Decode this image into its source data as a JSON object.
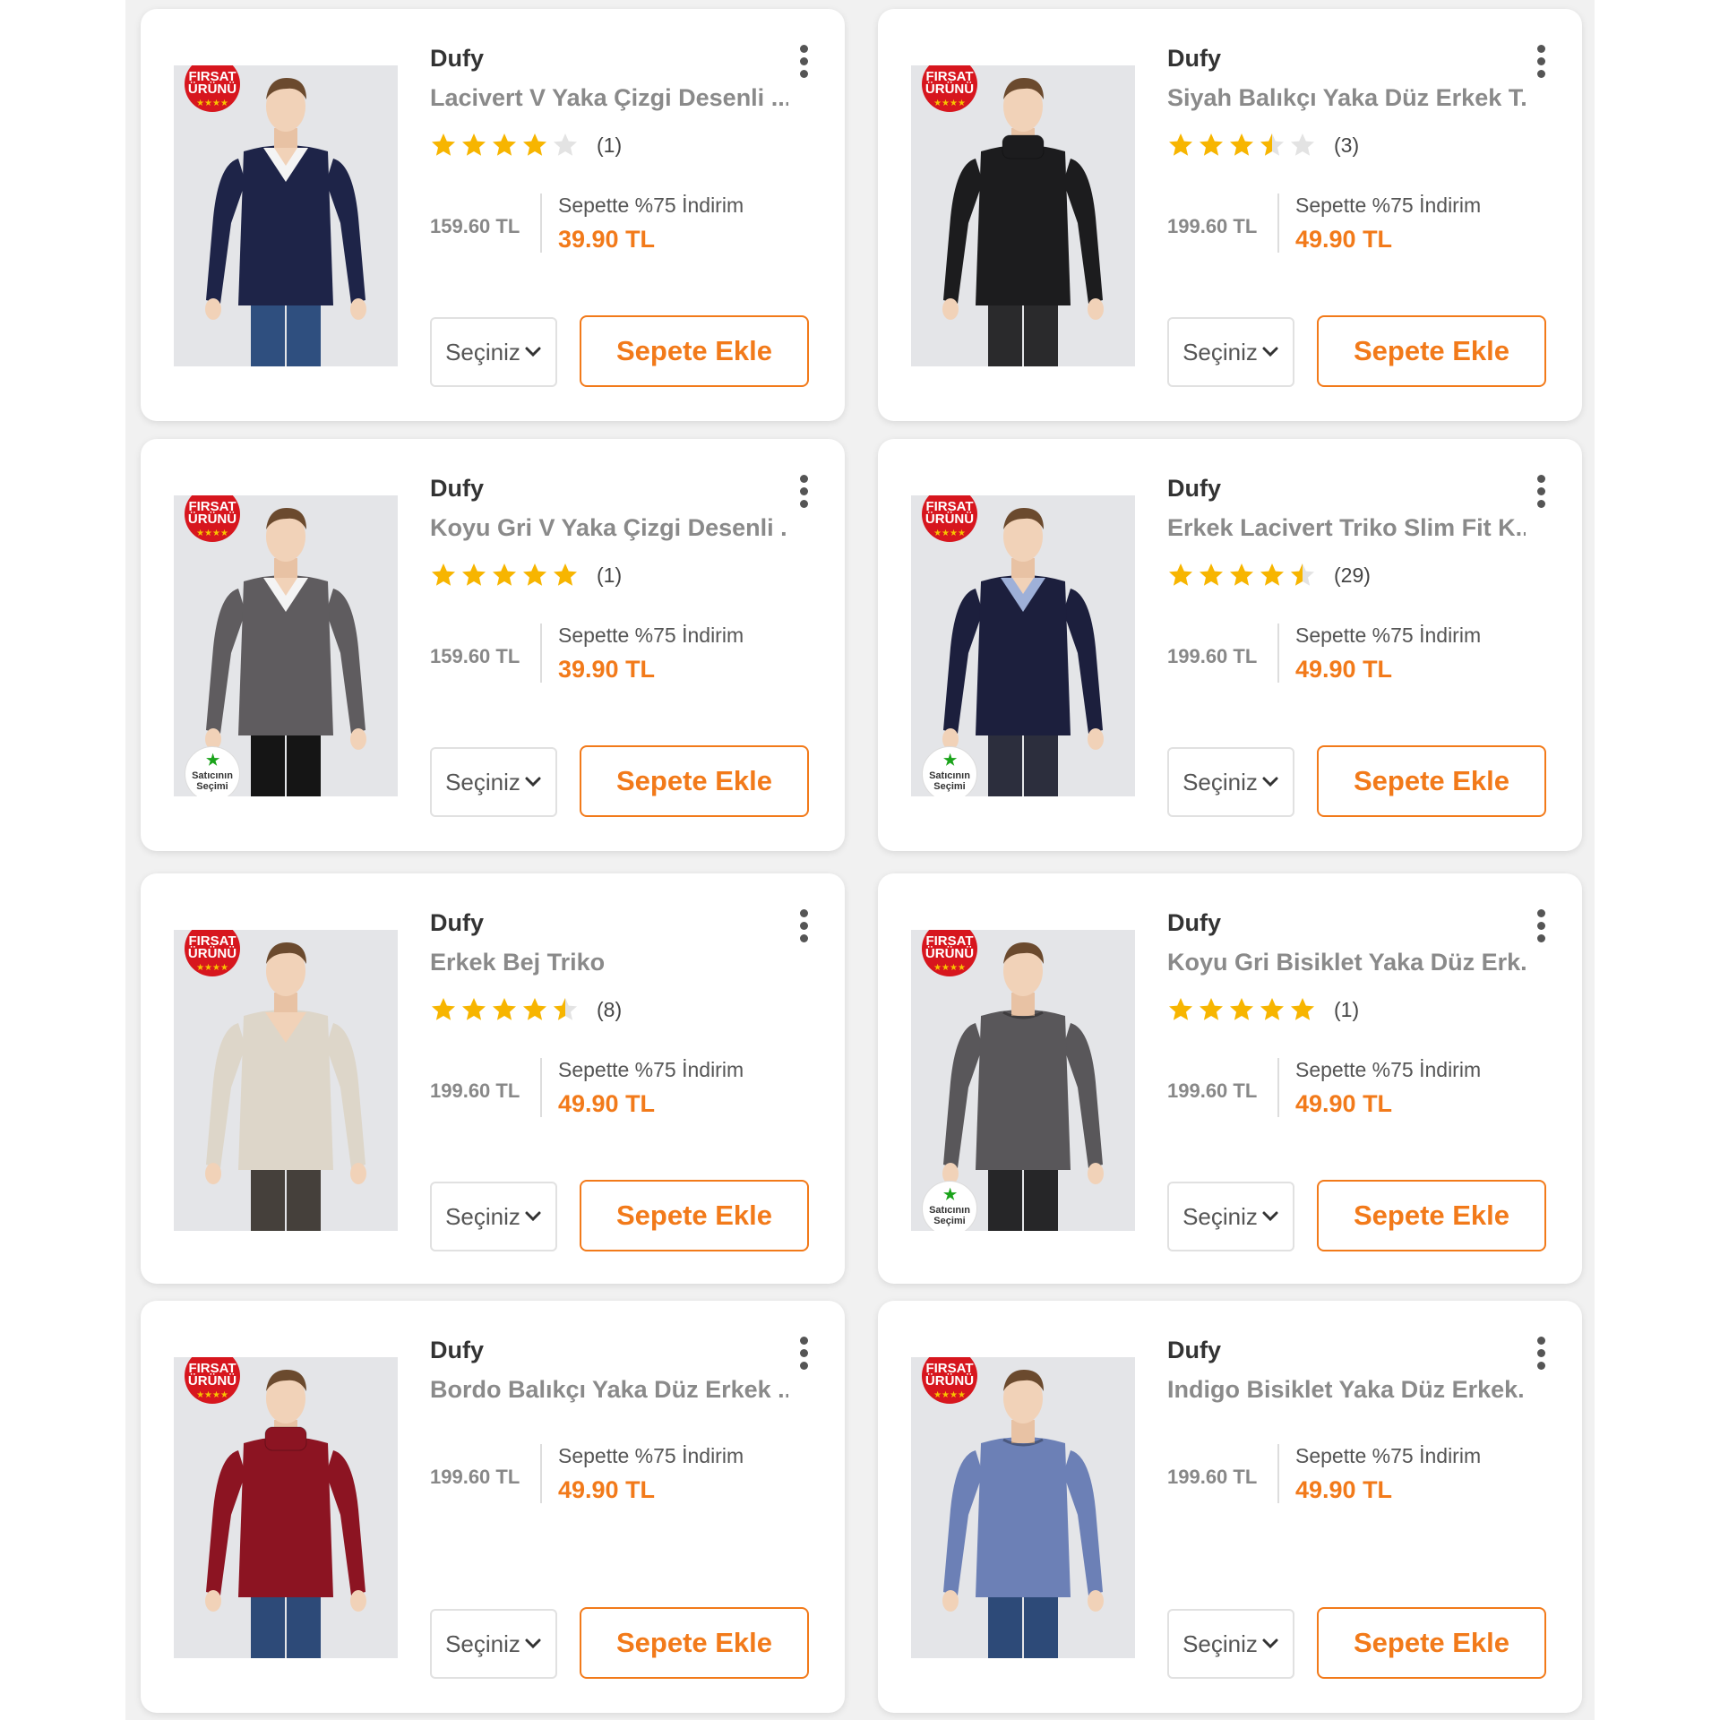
{
  "colors": {
    "accent": "#f27a1a",
    "star": "#f7b500",
    "star_empty": "#e3e3e3",
    "deal_badge": "#d7161e"
  },
  "badges": {
    "deal_line1": "FIRSAT",
    "deal_line2": "ÜRÜNÜ",
    "seller_line1": "Satıcının",
    "seller_line2": "Seçimi"
  },
  "products": [
    {
      "brand": "Dufy",
      "title": "Lacivert V Yaka Çizgi Desenli ...",
      "rating": 4,
      "rating_count": "(1)",
      "old_price": "159.60 TL",
      "promo_label": "Sepette %75 İndirim",
      "new_price": "39.90 TL",
      "select_label": "Seçiniz",
      "add_label": "Sepete Ekle",
      "sweater_color": "#1e2448",
      "collar": "v-shirt",
      "pants_color": "#2f4f7f",
      "seller_choice": false
    },
    {
      "brand": "Dufy",
      "title": "Siyah Balıkçı Yaka Düz Erkek T...",
      "rating": 3.5,
      "rating_count": "(3)",
      "old_price": "199.60 TL",
      "promo_label": "Sepette %75 İndirim",
      "new_price": "49.90 TL",
      "select_label": "Seçiniz",
      "add_label": "Sepete Ekle",
      "sweater_color": "#1c1c1e",
      "collar": "turtle",
      "pants_color": "#2a2a2c",
      "seller_choice": false
    },
    {
      "brand": "Dufy",
      "title": "Koyu Gri V Yaka Çizgi Desenli ...",
      "rating": 5,
      "rating_count": "(1)",
      "old_price": "159.60 TL",
      "promo_label": "Sepette %75 İndirim",
      "new_price": "39.90 TL",
      "select_label": "Seçiniz",
      "add_label": "Sepete Ekle",
      "sweater_color": "#5f5c5f",
      "collar": "v-shirt",
      "pants_color": "#151515",
      "seller_choice": true
    },
    {
      "brand": "Dufy",
      "title": "Erkek Lacivert Triko Slim Fit K...",
      "rating": 4.5,
      "rating_count": "(29)",
      "old_price": "199.60 TL",
      "promo_label": "Sepette %75 İndirim",
      "new_price": "49.90 TL",
      "select_label": "Seçiniz",
      "add_label": "Sepete Ekle",
      "sweater_color": "#1c1f3d",
      "collar": "v-shirt-blue",
      "pants_color": "#2c2e3d",
      "seller_choice": true
    },
    {
      "brand": "Dufy",
      "title": "Erkek Bej Triko",
      "rating": 4.5,
      "rating_count": "(8)",
      "old_price": "199.60 TL",
      "promo_label": "Sepette %75 İndirim",
      "new_price": "49.90 TL",
      "select_label": "Seçiniz",
      "add_label": "Sepete Ekle",
      "sweater_color": "#ddd6c9",
      "collar": "v",
      "pants_color": "#45403b",
      "seller_choice": false
    },
    {
      "brand": "Dufy",
      "title": "Koyu Gri Bisiklet Yaka Düz Erk...",
      "rating": 5,
      "rating_count": "(1)",
      "old_price": "199.60 TL",
      "promo_label": "Sepette %75 İndirim",
      "new_price": "49.90 TL",
      "select_label": "Seçiniz",
      "add_label": "Sepete Ekle",
      "sweater_color": "#59575a",
      "collar": "crew",
      "pants_color": "#262628",
      "seller_choice": true
    },
    {
      "brand": "Dufy",
      "title": "Bordo Balıkçı Yaka Düz Erkek ...",
      "rating": null,
      "rating_count": "",
      "old_price": "199.60 TL",
      "promo_label": "Sepette %75 İndirim",
      "new_price": "49.90 TL",
      "select_label": "Seçiniz",
      "add_label": "Sepete Ekle",
      "sweater_color": "#8c1422",
      "collar": "turtle",
      "pants_color": "#2d4a78",
      "seller_choice": false
    },
    {
      "brand": "Dufy",
      "title": "Indigo Bisiklet Yaka Düz Erkek...",
      "rating": null,
      "rating_count": "",
      "old_price": "199.60 TL",
      "promo_label": "Sepette %75 İndirim",
      "new_price": "49.90 TL",
      "select_label": "Seçiniz",
      "add_label": "Sepete Ekle",
      "sweater_color": "#6c80b6",
      "collar": "crew",
      "pants_color": "#2d4a78",
      "seller_choice": false
    }
  ]
}
